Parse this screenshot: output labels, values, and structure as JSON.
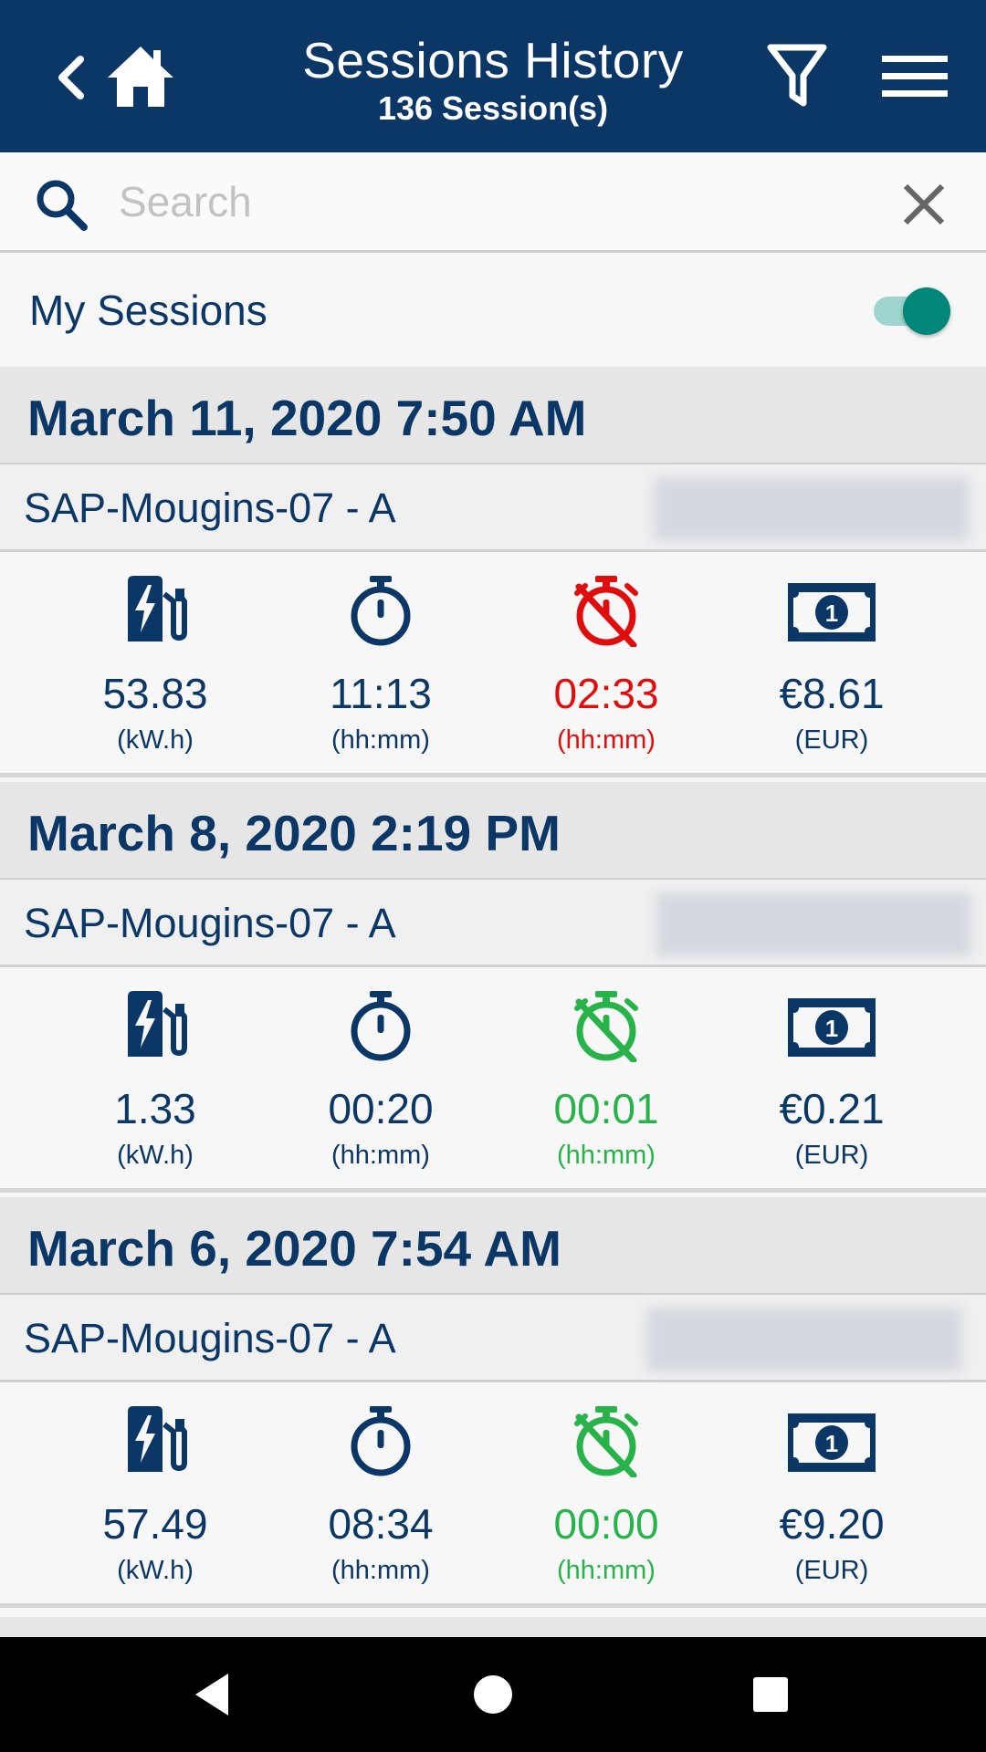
{
  "header": {
    "title": "Sessions History",
    "subtitle": "136 Session(s)"
  },
  "search": {
    "placeholder": "Search",
    "value": ""
  },
  "my_sessions": {
    "label": "My Sessions",
    "enabled": true
  },
  "colors": {
    "primary": "#0b3766",
    "red": "#e00d0d",
    "green": "#28b34a",
    "toggle_on": "#00877a"
  },
  "sessions": [
    {
      "date": "March 11, 2020 7:50 AM",
      "station": "SAP-Mougins-07 - A",
      "energy": {
        "value": "53.83",
        "unit": "(kW.h)"
      },
      "duration": {
        "value": "11:13",
        "unit": "(hh:mm)"
      },
      "inactivity": {
        "value": "02:33",
        "unit": "(hh:mm)",
        "status": "red"
      },
      "price": {
        "value": "€8.61",
        "unit": "(EUR)"
      }
    },
    {
      "date": "March 8, 2020 2:19 PM",
      "station": "SAP-Mougins-07 - A",
      "energy": {
        "value": "1.33",
        "unit": "(kW.h)"
      },
      "duration": {
        "value": "00:20",
        "unit": "(hh:mm)"
      },
      "inactivity": {
        "value": "00:01",
        "unit": "(hh:mm)",
        "status": "green"
      },
      "price": {
        "value": "€0.21",
        "unit": "(EUR)"
      }
    },
    {
      "date": "March 6, 2020 7:54 AM",
      "station": "SAP-Mougins-07 - A",
      "energy": {
        "value": "57.49",
        "unit": "(kW.h)"
      },
      "duration": {
        "value": "08:34",
        "unit": "(hh:mm)"
      },
      "inactivity": {
        "value": "00:00",
        "unit": "(hh:mm)",
        "status": "green"
      },
      "price": {
        "value": "€9.20",
        "unit": "(EUR)"
      }
    }
  ],
  "icons": {
    "back": "chevron-left-icon",
    "home": "home-icon",
    "filter": "filter-icon",
    "menu": "menu-icon",
    "search": "search-icon",
    "clear": "close-icon",
    "energy": "ev-charger-icon",
    "duration": "stopwatch-icon",
    "inactivity": "stopwatch-off-icon",
    "price": "banknote-icon"
  }
}
